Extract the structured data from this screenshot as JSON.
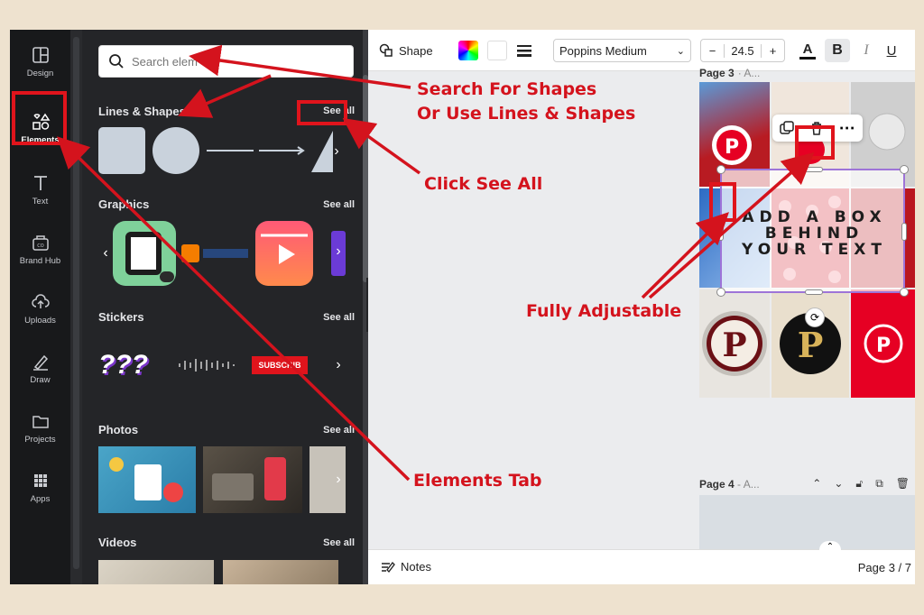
{
  "rail": {
    "items": [
      {
        "label": "Design",
        "icon": "design-icon"
      },
      {
        "label": "Elements",
        "icon": "elements-icon",
        "active": true
      },
      {
        "label": "Text",
        "icon": "text-icon"
      },
      {
        "label": "Brand Hub",
        "icon": "brand-hub-icon"
      },
      {
        "label": "Uploads",
        "icon": "upload-icon"
      },
      {
        "label": "Draw",
        "icon": "draw-icon"
      },
      {
        "label": "Projects",
        "icon": "folder-icon"
      },
      {
        "label": "Apps",
        "icon": "apps-grid-icon"
      }
    ]
  },
  "panel": {
    "search_placeholder": "Search elem",
    "sections": [
      {
        "title": "Lines & Shapes",
        "see_all": "See all"
      },
      {
        "title": "Graphics",
        "see_all": "See all"
      },
      {
        "title": "Stickers",
        "see_all": "See all"
      },
      {
        "title": "Photos",
        "see_all": "See all"
      },
      {
        "title": "Videos",
        "see_all": "See all"
      }
    ],
    "sticker_text": "SUBSCRIB"
  },
  "toolbar": {
    "shape_label": "Shape",
    "font_name": "Poppins Medium",
    "font_size": "24.5",
    "minus": "−",
    "plus": "+",
    "text_color_label": "A",
    "bold_label": "B",
    "italic_label": "I",
    "underline_label": "U"
  },
  "canvas": {
    "page3_label": "Page 3",
    "page3_suffix": "· A...",
    "page4_label": "Page 4",
    "page4_suffix": "- A...",
    "box_text": [
      "ADD A BOX",
      "BEHIND",
      "YOUR TEXT"
    ]
  },
  "statusbar": {
    "notes_label": "Notes",
    "page_indicator": "Page 3 / 7"
  },
  "annotations": {
    "search": "Search For Shapes",
    "or_use": "Or Use Lines & Shapes",
    "click_see_all": "Click See All",
    "fully_adjustable": "Fully Adjustable",
    "elements_tab": "Elements Tab"
  },
  "colors": {
    "annotation_red": "#d4131d",
    "panel_bg": "#242528",
    "rail_bg": "#18191b",
    "selection_purple": "#9e74d8",
    "pinterest_red": "#e60023"
  }
}
